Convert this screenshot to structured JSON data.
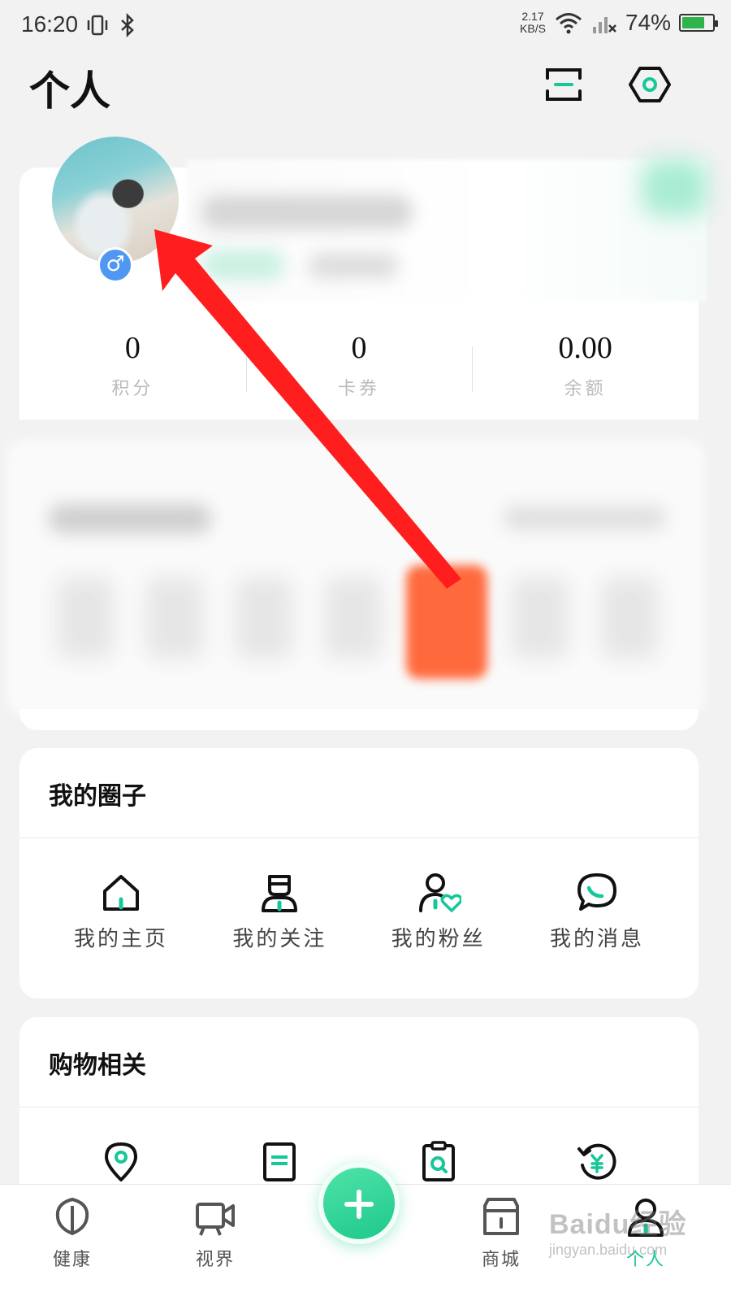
{
  "status_bar": {
    "time": "16:20",
    "net_speed_value": "2.17",
    "net_speed_unit": "KB/S",
    "battery_text": "74%",
    "battery_level": 0.74,
    "icons": [
      "vibrate-icon",
      "bluetooth-icon",
      "wifi-icon",
      "signal-icon",
      "battery-icon"
    ]
  },
  "header": {
    "title": "个人",
    "icons": [
      "scan-icon",
      "settings-icon"
    ]
  },
  "profile": {
    "gender_symbol": "♂",
    "stats": [
      {
        "value": "0",
        "label": "积分"
      },
      {
        "value": "0",
        "label": "卡券"
      },
      {
        "value": "0.00",
        "label": "余额"
      }
    ]
  },
  "circle_section": {
    "title": "我的圈子",
    "items": [
      {
        "label": "我的主页",
        "icon": "home-icon"
      },
      {
        "label": "我的关注",
        "icon": "follow-icon"
      },
      {
        "label": "我的粉丝",
        "icon": "fans-icon"
      },
      {
        "label": "我的消息",
        "icon": "message-icon"
      }
    ]
  },
  "shopping_section": {
    "title": "购物相关",
    "items": [
      {
        "icon": "location-icon"
      },
      {
        "icon": "order-icon"
      },
      {
        "icon": "search-clipboard-icon"
      },
      {
        "icon": "refund-icon"
      }
    ]
  },
  "bottom_nav": {
    "items": [
      {
        "label": "健康",
        "icon": "leaf-icon"
      },
      {
        "label": "视界",
        "icon": "video-camera-icon"
      },
      {
        "label": "商城",
        "icon": "store-icon"
      },
      {
        "label": "个人",
        "icon": "person-icon",
        "active": true
      }
    ],
    "accent": "#16c79a"
  },
  "watermark": {
    "main": "Baidu经验",
    "sub": "jingyan.baidu.com"
  },
  "colors": {
    "accent": "#16c79a",
    "arrow": "#ff1e1e",
    "gender_badge": "#4f97f1"
  }
}
